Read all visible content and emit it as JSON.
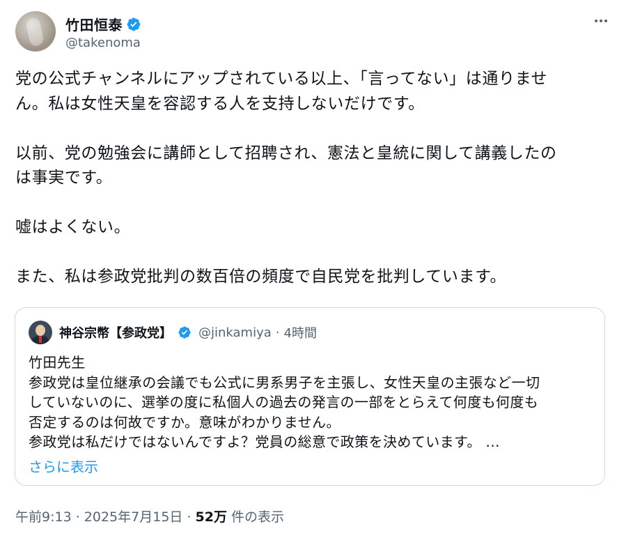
{
  "author": {
    "name": "竹田恒泰",
    "handle": "@takenoma",
    "verified": true
  },
  "more_icon": "more-horizontal-icon",
  "tweet": {
    "paragraphs": [
      [
        "党の公式チャンネルにアップされている以上、「言ってない」は通りませ",
        "ん。私は女性天皇を容認する人を支持しないだけです。"
      ],
      [
        "以前、党の勉強会に講師として招聘され、憲法と皇統に関して講義したの",
        "は事実です。"
      ],
      [
        "嘘はよくない。"
      ],
      [
        "また、私は参政党批判の数百倍の頻度で自民党を批判しています。"
      ]
    ]
  },
  "quote": {
    "name": "神谷宗幣【参政党】",
    "handle": "@jinkamiya",
    "separator": "·",
    "time": "4時間",
    "lines": [
      "竹田先生",
      "参政党は皇位継承の会議でも公式に男系男子を主張し、女性天皇の主張など一切",
      "していないのに、選挙の度に私個人の過去の発言の一部をとらえて何度も何度も",
      "否定するのは何故ですか。意味がわかりません。",
      "参政党は私だけではないんですよ？党員の総意で政策を決めています。 ..."
    ],
    "show_more": "さらに表示"
  },
  "meta": {
    "timestamp": "午前9:13 · 2025年7月15日 · ",
    "views_count": "52万",
    "views_label": " 件の表示"
  },
  "colors": {
    "text": "#0f1419",
    "secondary": "#536471",
    "link": "#1d9bf0",
    "verified": "#1d9bf0",
    "border": "#cfd9de"
  }
}
